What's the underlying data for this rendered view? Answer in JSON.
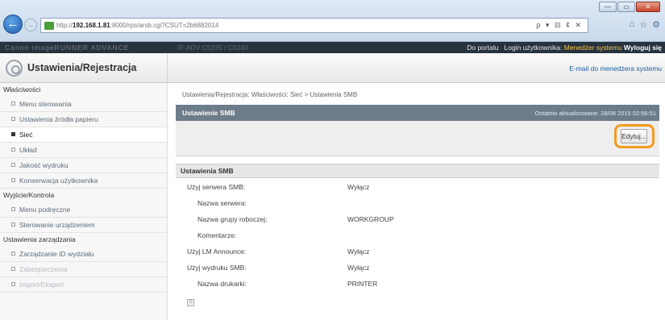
{
  "browser": {
    "url_prefix": "http://",
    "url_host": "192.168.1.81",
    "url_rest": ":8000/rps/arsb.cgi?CSUT=2b6882014",
    "search_tools": "ρ ▾ ⊟ ¢ ✕",
    "window_buttons": [
      "—",
      "▭",
      "✕"
    ],
    "toolbar_icons": [
      "⌂",
      "☆",
      "⚙"
    ]
  },
  "topbar": {
    "blurred_left": "Canon imageRUNNER ADVANCE",
    "blurred_mid": "iR-ADV C5235 / C5240",
    "portal_link": "Do portalu",
    "login_label": "Login użytkownika:",
    "user": "Menedżer systemu",
    "logout": "Wyloguj się"
  },
  "header": {
    "title": "Ustawienia/Rejestracja",
    "admin_mail": "E-mail do menedżera systemu"
  },
  "sidebar": {
    "sections": [
      {
        "label": "Właściwości",
        "items": [
          {
            "label": "Menu sterowania",
            "active": false
          },
          {
            "label": "Ustawienia źródła papieru",
            "active": false
          },
          {
            "label": "Sieć",
            "active": true
          },
          {
            "label": "Układ",
            "active": false
          },
          {
            "label": "Jakość wydruku",
            "active": false
          },
          {
            "label": "Konserwacja użytkownika",
            "active": false
          }
        ]
      },
      {
        "label": "Wyjście/Kontrola",
        "items": [
          {
            "label": "Menu podręczne",
            "active": false
          },
          {
            "label": "Sterowanie urządzeniem",
            "active": false
          }
        ]
      },
      {
        "label": "Ustawienia zarządzania",
        "items": [
          {
            "label": "Zarządzanie ID wydziału",
            "active": false
          },
          {
            "label": "Zabezpieczenia",
            "active": false
          },
          {
            "label": "Import/Eksport",
            "active": false
          }
        ]
      }
    ]
  },
  "main": {
    "breadcrumb": "Ustawienia/Rejestracja: Właściwości: Sieć > Ustawienia SMB",
    "bar_title": "Ustawienie SMB",
    "last_updated": "Ostatnio aktualizowane: 28/08 2015 02:56:51",
    "edit_button": "Edytuj...",
    "section_title": "Ustawienia SMB",
    "rows": [
      {
        "label": "Użyj serwera SMB:",
        "value": "Wyłącz",
        "level": 1
      },
      {
        "label": "Nazwa serwera:",
        "value": "",
        "level": 2
      },
      {
        "label": "Nazwa grupy roboczej:",
        "value": "WORKGROUP",
        "level": 2
      },
      {
        "label": "Komentarze:",
        "value": "",
        "level": 2
      },
      {
        "label": "Użyj LM Announce:",
        "value": "Wyłącz",
        "level": 1
      },
      {
        "label": "Użyj wydruku SMB:",
        "value": "Wyłącz",
        "level": 1
      },
      {
        "label": "Nazwa drukarki:",
        "value": "PRINTER",
        "level": 2
      }
    ]
  }
}
